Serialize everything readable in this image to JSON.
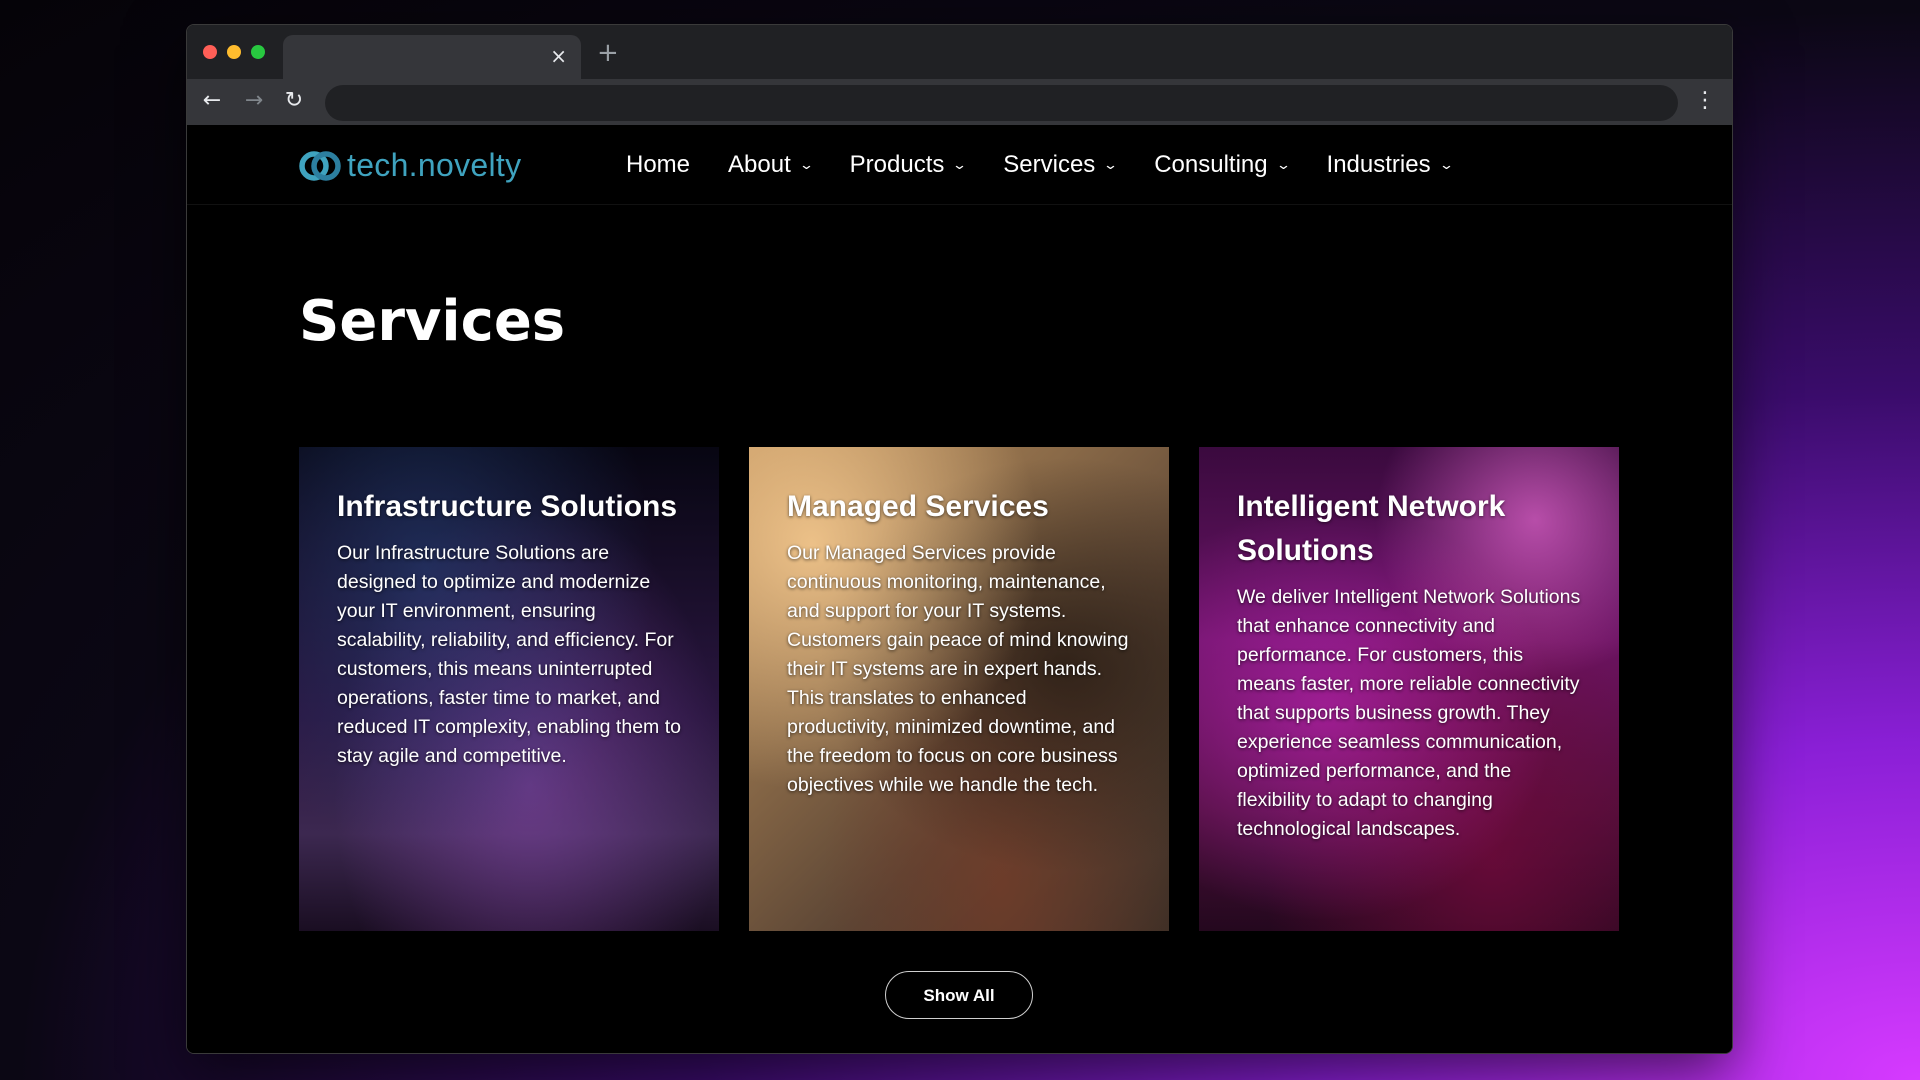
{
  "browser": {
    "tab_close": "×",
    "new_tab": "+",
    "back": "←",
    "forward": "→",
    "reload": "↻",
    "menu": "⋮"
  },
  "site": {
    "logo_text": "tech.novelty",
    "brand_color": "#3fa3bf",
    "nav": [
      {
        "label": "Home",
        "has_dropdown": false
      },
      {
        "label": "About",
        "has_dropdown": true
      },
      {
        "label": "Products",
        "has_dropdown": true
      },
      {
        "label": "Services",
        "has_dropdown": true
      },
      {
        "label": "Consulting",
        "has_dropdown": true
      },
      {
        "label": "Industries",
        "has_dropdown": true
      }
    ],
    "dropdown_icon": "chevron-down-icon"
  },
  "main": {
    "title": "Services",
    "cards": [
      {
        "title": "Infrastructure Solutions",
        "text": "Our Infrastructure Solutions are designed to optimize and modernize your IT environment, ensuring scalability, reliability, and efficiency. For customers, this means uninterrupted operations, faster time to market, and reduced IT complexity, enabling them to stay agile and competitive."
      },
      {
        "title": "Managed Services",
        "text": "Our Managed Services provide continuous monitoring, maintenance, and support for your IT systems. Customers gain peace of mind knowing their IT systems are in expert hands. This translates to enhanced productivity, minimized downtime, and the freedom to focus on core business objectives while we handle the tech."
      },
      {
        "title": "Intelligent Network Solutions",
        "text": "We deliver Intelligent Network Solutions that enhance connectivity and performance. For customers, this means faster, more reliable connectivity that supports business growth. They experience seamless communication, optimized performance, and the flexibility to adapt to changing technological landscapes."
      }
    ],
    "show_all_label": "Show All"
  }
}
